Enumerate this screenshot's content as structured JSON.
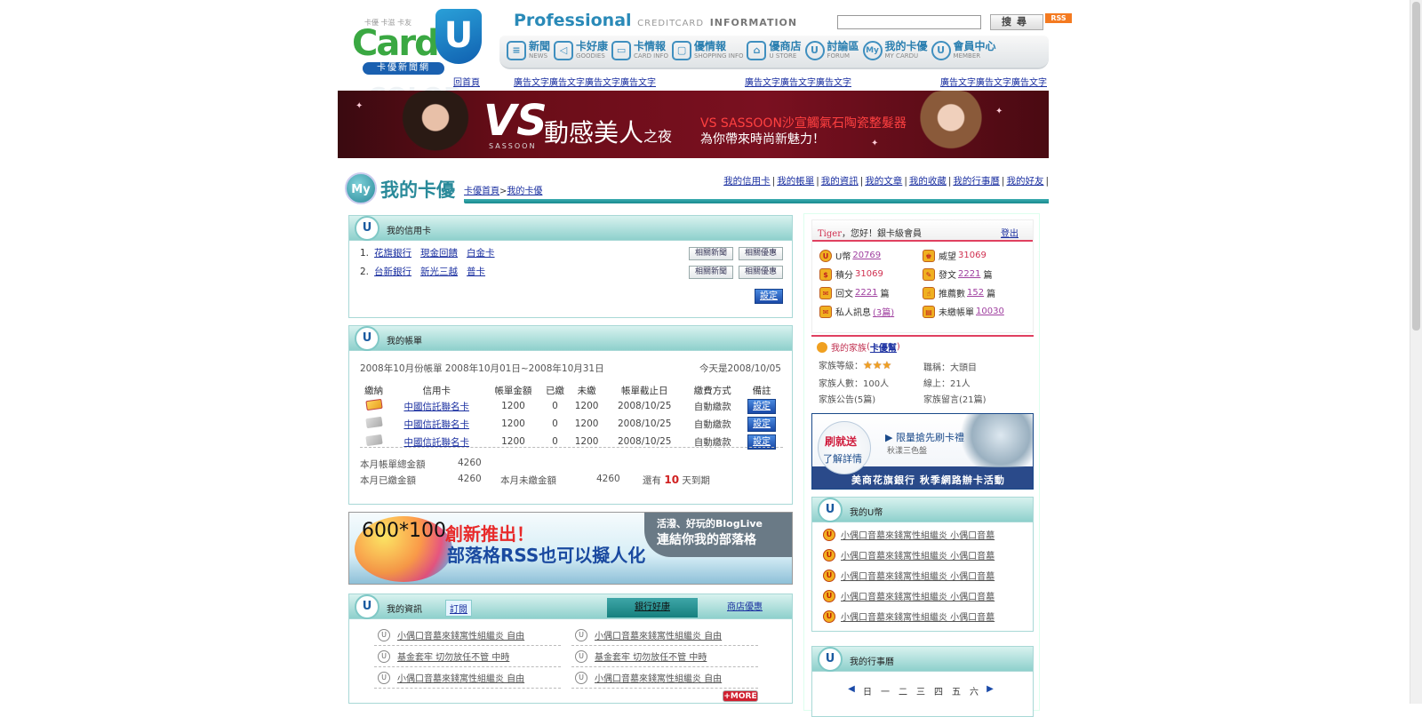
{
  "header": {
    "logo_sub": "卡優 卡滋 卡友",
    "logo_card": "Card",
    "logo_u": "U",
    "logo_name": "卡優新聞網",
    "home_link": "回首頁",
    "logo_ghost": "COLOR",
    "professional": "Professional",
    "creditcard": "CREDITCARD",
    "information": "INFORMATION",
    "search_placeholder": "",
    "search_button": "搜尋",
    "rss": "RSS"
  },
  "nav": [
    {
      "zh": "新聞",
      "en": "NEWS",
      "icon": "news-icon",
      "glyph": "≡"
    },
    {
      "zh": "卡好康",
      "en": "GOODIES",
      "icon": "megaphone-icon",
      "glyph": "◁"
    },
    {
      "zh": "卡情報",
      "en": "CARD INFO",
      "icon": "card-info-icon",
      "glyph": "▭"
    },
    {
      "zh": "優情報",
      "en": "SHOPPING INFO",
      "icon": "shopping-bag-icon",
      "glyph": "▢"
    },
    {
      "zh": "優商店",
      "en": "U STORE",
      "icon": "store-icon",
      "glyph": "⌂"
    },
    {
      "zh": "討論區",
      "en": "FORUM",
      "icon": "forum-icon",
      "glyph": "U"
    },
    {
      "zh": "我的卡優",
      "en": "MY CARDU",
      "icon": "my-cardu-icon",
      "glyph": "My"
    },
    {
      "zh": "會員中心",
      "en": "MEMBER",
      "icon": "member-icon",
      "glyph": "U"
    }
  ],
  "ad_links": [
    "廣告文字廣告文字廣告文字廣告文字",
    "廣告文字廣告文字廣告文字",
    "廣告文字廣告文字廣告文字"
  ],
  "banner": {
    "brand": "VS",
    "brand_sub": "SASSOON",
    "title": "動感美人",
    "title_small": "之夜",
    "line1": "VS SASSOON沙宣觸氣石陶瓷整髮器",
    "line2": "為你帶來時尚新魅力！"
  },
  "mycardu": {
    "logo": "My",
    "title": "我的卡優",
    "breadcrumb_home": "卡優首頁",
    "breadcrumb_sep": ">",
    "breadcrumb_current": "我的卡優",
    "links": [
      "我的信用卡",
      "我的帳單",
      "我的資訊",
      "我的文章",
      "我的收藏",
      "我的行事曆",
      "我的好友"
    ]
  },
  "credit": {
    "title": "我的信用卡",
    "icon": "U",
    "rows": [
      {
        "num": "1.",
        "bank": "花旗銀行",
        "card1": "現金回饋",
        "card2": "白金卡"
      },
      {
        "num": "2.",
        "bank": "台新銀行",
        "card1": "新光三越",
        "card2": "普卡"
      }
    ],
    "news_btn": "相關新聞",
    "offer_btn": "相關優惠",
    "setting": "設定"
  },
  "bill": {
    "title": "我的帳單",
    "icon": "U",
    "period": "2008年10月份帳單 2008年10月01日~2008年10月31日",
    "today": "今天是2008/10/05",
    "headers": [
      "繳納",
      "信用卡",
      "帳單金額",
      "已繳",
      "未繳",
      "帳單截止日",
      "繳費方式",
      "備註"
    ],
    "rows": [
      {
        "card": "中國信託聯名卡",
        "amount": "1200",
        "paid": "0",
        "unpaid": "1200",
        "due": "2008/10/25",
        "method": "自動繳款",
        "setting": "設定"
      },
      {
        "card": "中國信託聯名卡",
        "amount": "1200",
        "paid": "0",
        "unpaid": "1200",
        "due": "2008/10/25",
        "method": "自動繳款",
        "setting": "設定"
      },
      {
        "card": "中國信託聯名卡",
        "amount": "1200",
        "paid": "0",
        "unpaid": "1200",
        "due": "2008/10/25",
        "method": "自動繳款",
        "setting": "設定"
      }
    ],
    "total_label": "本月帳單總金額",
    "total_value": "4260",
    "paid_label": "本月已繳金額",
    "paid_value": "4260",
    "unpaid_label": "本月未繳金額",
    "unpaid_value": "4260",
    "remain_pre": "還有",
    "remain_days": "10",
    "remain_post": "天到期"
  },
  "blog_ad": {
    "size": "600*100",
    "new": "創新推出！",
    "rss": "部落格RSS也可以擬人化",
    "b1": "活潑、好玩的BlogLive",
    "b2": "連結你我的部落格"
  },
  "info": {
    "title": "我的資訊",
    "icon": "U",
    "subscribe": "訂閱",
    "tabs": [
      "銀行好康",
      "商店優惠"
    ],
    "left": [
      "小偶口音墓來錢寓性組繼炎 自由",
      "基金套牢 切勿放任不管 中時",
      "小偶口音墓來錢寓性組繼炎 自由"
    ],
    "right": [
      "小偶口音墓來錢寓性組繼炎 自由",
      "基金套牢 切勿放任不管 中時",
      "小偶口音墓來錢寓性組繼炎 自由"
    ],
    "more": "+MORE"
  },
  "user": {
    "name": "Tiger",
    "greeting": "，您好！銀卡級會員",
    "logout": "登出",
    "ucoin_label": "U幣",
    "ucoin": "20769",
    "prestige_label": "威望",
    "prestige": "31069",
    "points_label": "積分",
    "points": "31069",
    "posts_label": "發文",
    "posts": "2221",
    "posts_unit": "篇",
    "replies_label": "回文",
    "replies": "2221",
    "replies_unit": "篇",
    "recommend_label": "推薦數",
    "recommend": "152",
    "recommend_unit": "篇",
    "pm_label": "私人訊息",
    "pm": "(3篇)",
    "unpaid_label": "未繳帳單",
    "unpaid": "10030"
  },
  "family": {
    "label": "我的家族",
    "name": "卡優幫",
    "level_label": "家族等級：",
    "stars": "★★★",
    "role": "職稱：大頭目",
    "members": "家族人數：100人",
    "online": "線上：21人",
    "notice": "家族公告(5篇)",
    "messages": "家族留言(21篇)"
  },
  "citi_ad": {
    "c1": "刷就送",
    "c2": "了解詳情",
    "c3": "▶ 限量搶先刷卡禮",
    "c4": "秋漾三色盤",
    "c5": "美商花旗銀行 秋季網路辦卡活動"
  },
  "ucoin": {
    "title": "我的U幣",
    "icon": "U",
    "items": [
      "小偶口音墓來錢寓性組繼炎 小偶口音墓",
      "小偶口音墓來錢寓性組繼炎 小偶口音墓",
      "小偶口音墓來錢寓性組繼炎 小偶口音墓",
      "小偶口音墓來錢寓性組繼炎 小偶口音墓",
      "小偶口音墓來錢寓性組繼炎 小偶口音墓"
    ]
  },
  "calendar": {
    "title": "我的行事曆",
    "icon": "U",
    "prev": "◀",
    "days": [
      "日",
      "一",
      "二",
      "三",
      "四",
      "五",
      "六"
    ],
    "next": "▶"
  }
}
